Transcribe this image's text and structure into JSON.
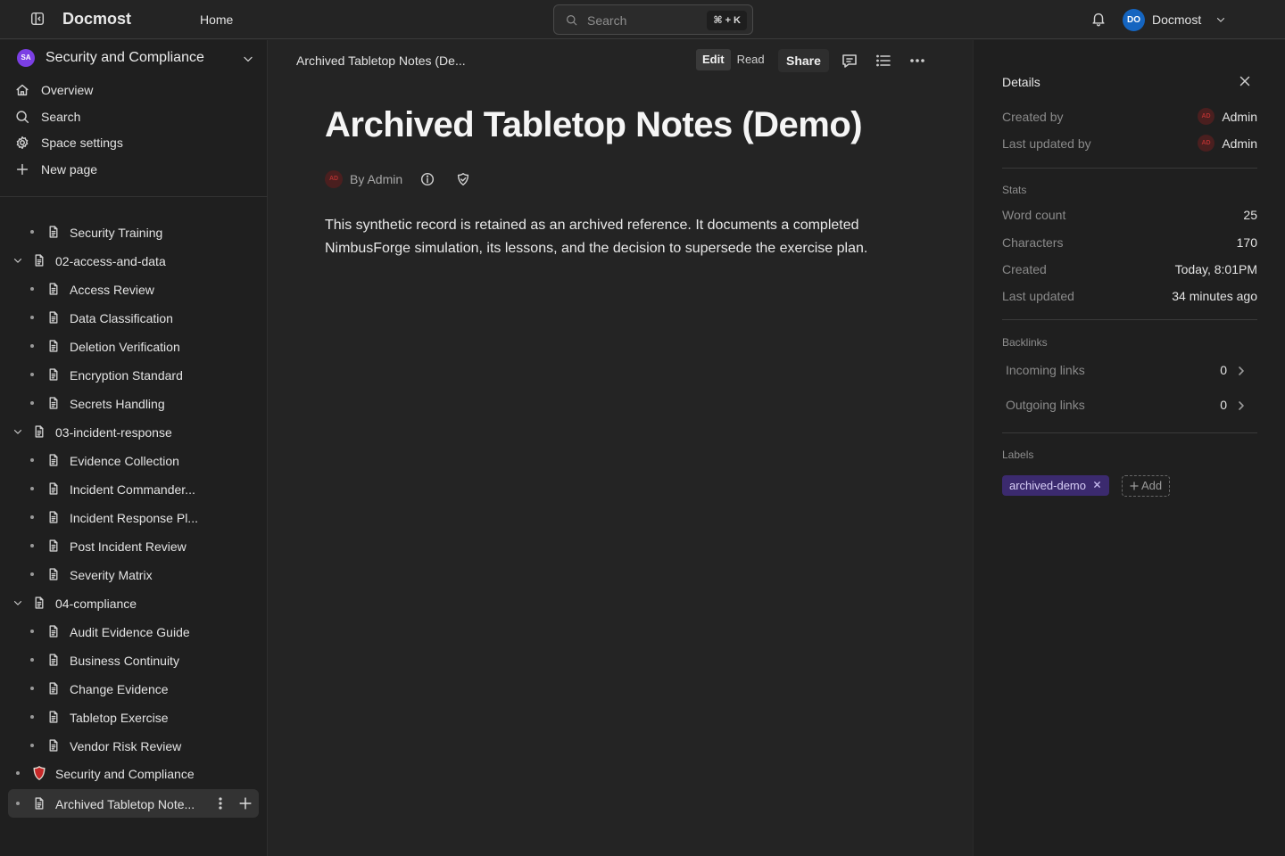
{
  "app": {
    "brand": "Docmost",
    "home_label": "Home",
    "search_placeholder": "Search",
    "search_shortcut": "⌘ + K",
    "user_initials": "DO",
    "user_name": "Docmost"
  },
  "sidebar": {
    "space_initials": "SA",
    "space_name": "Security and Compliance",
    "nav": [
      {
        "label": "Overview",
        "icon": "home-icon"
      },
      {
        "label": "Search",
        "icon": "search-icon"
      },
      {
        "label": "Space settings",
        "icon": "gear-icon"
      },
      {
        "label": "New page",
        "icon": "plus-icon"
      }
    ],
    "tree": [
      {
        "label": "Security Training",
        "level": 1,
        "kind": "page"
      },
      {
        "label": "02-access-and-data",
        "level": 0,
        "kind": "folder"
      },
      {
        "label": "Access Review",
        "level": 1,
        "kind": "page"
      },
      {
        "label": "Data Classification",
        "level": 1,
        "kind": "page"
      },
      {
        "label": "Deletion Verification",
        "level": 1,
        "kind": "page"
      },
      {
        "label": "Encryption Standard",
        "level": 1,
        "kind": "page"
      },
      {
        "label": "Secrets Handling",
        "level": 1,
        "kind": "page"
      },
      {
        "label": "03-incident-response",
        "level": 0,
        "kind": "folder"
      },
      {
        "label": "Evidence Collection",
        "level": 1,
        "kind": "page"
      },
      {
        "label": "Incident Commander...",
        "level": 1,
        "kind": "page"
      },
      {
        "label": "Incident Response Pl...",
        "level": 1,
        "kind": "page"
      },
      {
        "label": "Post Incident Review",
        "level": 1,
        "kind": "page"
      },
      {
        "label": "Severity Matrix",
        "level": 1,
        "kind": "page"
      },
      {
        "label": "04-compliance",
        "level": 0,
        "kind": "folder"
      },
      {
        "label": "Audit Evidence Guide",
        "level": 1,
        "kind": "page"
      },
      {
        "label": "Business Continuity",
        "level": 1,
        "kind": "page"
      },
      {
        "label": "Change Evidence",
        "level": 1,
        "kind": "page"
      },
      {
        "label": "Tabletop Exercise",
        "level": 1,
        "kind": "page"
      },
      {
        "label": "Vendor Risk Review",
        "level": 1,
        "kind": "page"
      },
      {
        "label": "Security and Compliance",
        "level": 0,
        "kind": "shield"
      },
      {
        "label": "Archived Tabletop Note...",
        "level": 0,
        "kind": "selected"
      }
    ]
  },
  "page": {
    "breadcrumb": "Archived Tabletop Notes (De...",
    "mode_edit": "Edit",
    "mode_read": "Read",
    "share_label": "Share",
    "title": "Archived Tabletop Notes (Demo)",
    "author_initials": "AD",
    "byline": "By Admin",
    "body": "This synthetic record is retained as an archived reference. It documents a completed NimbusForge simulation, its lessons, and the decision to supersede the exercise plan."
  },
  "details": {
    "title": "Details",
    "created_by_label": "Created by",
    "created_by_initials": "AD",
    "created_by": "Admin",
    "updated_by_label": "Last updated by",
    "updated_by_initials": "AD",
    "updated_by": "Admin",
    "stats_heading": "Stats",
    "word_count_label": "Word count",
    "word_count": "25",
    "characters_label": "Characters",
    "characters": "170",
    "created_label": "Created",
    "created": "Today, 8:01PM",
    "updated_label": "Last updated",
    "updated": "34 minutes ago",
    "backlinks_heading": "Backlinks",
    "incoming_label": "Incoming links",
    "incoming": "0",
    "outgoing_label": "Outgoing links",
    "outgoing": "0",
    "labels_heading": "Labels",
    "label_chip": "archived-demo",
    "add_label": "Add",
    "label_color": "#3b2a6e"
  }
}
